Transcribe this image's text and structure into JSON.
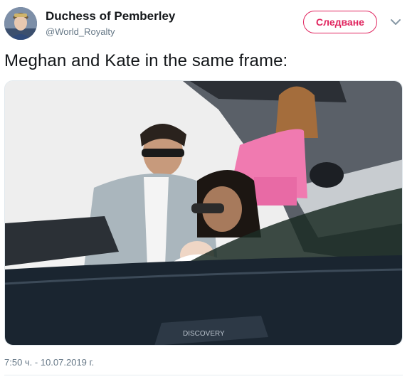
{
  "tweet": {
    "display_name": "Duchess of Pemberley",
    "handle": "@World_Royalty",
    "follow_label": "Следване",
    "text": "Meghan and Kate in the same frame:",
    "timestamp": "7:50 ч. - 10.07.2019 г.",
    "accent_color": "#e0245e"
  },
  "icons": {
    "caret": "chevron-down-icon"
  },
  "media": {
    "car_badge_text": "DISCOVERY"
  }
}
